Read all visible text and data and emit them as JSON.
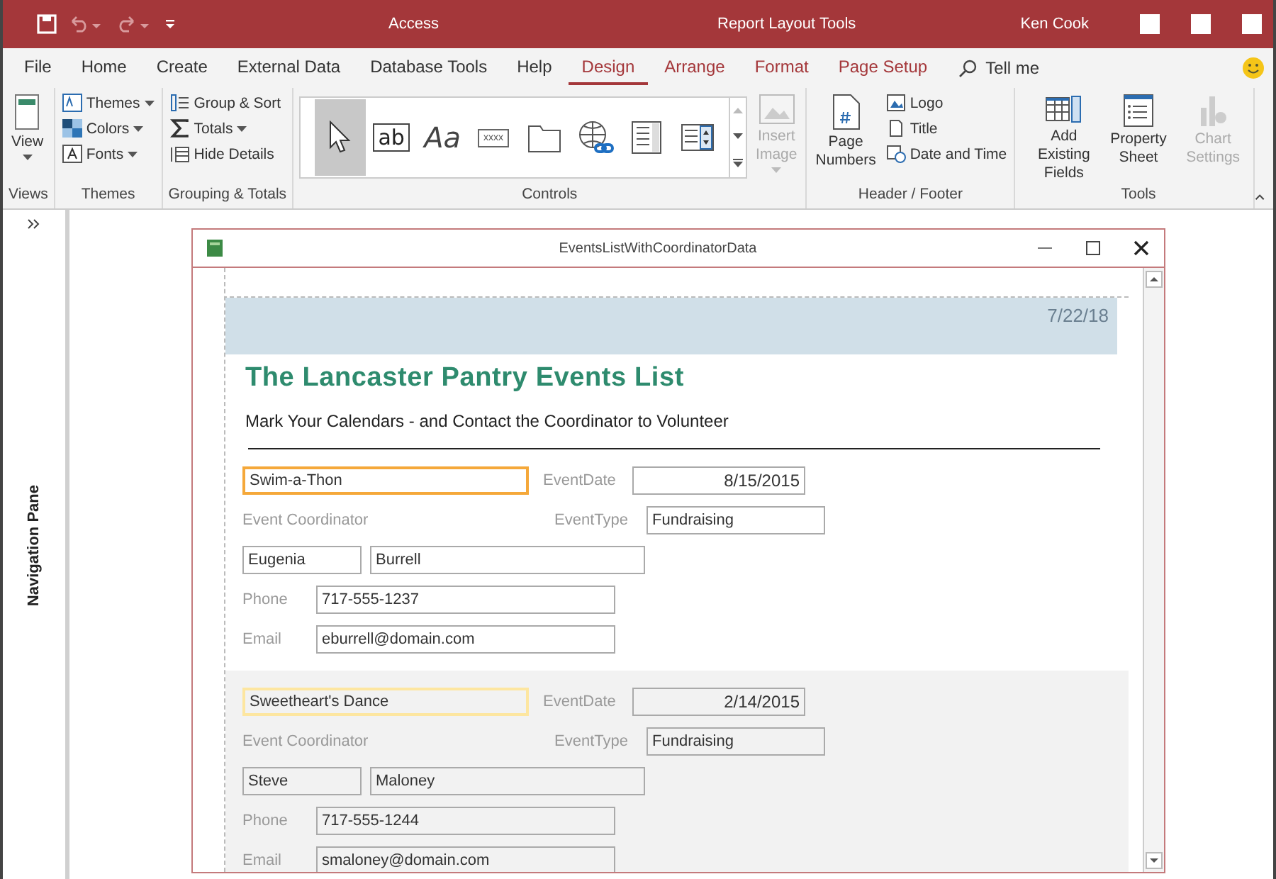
{
  "title_bar": {
    "app": "Access",
    "context": "Report Layout Tools",
    "user": "Ken Cook"
  },
  "tabs": [
    {
      "label": "File",
      "selected": false,
      "contextual": false
    },
    {
      "label": "Home",
      "selected": false,
      "contextual": false
    },
    {
      "label": "Create",
      "selected": false,
      "contextual": false
    },
    {
      "label": "External Data",
      "selected": false,
      "contextual": false
    },
    {
      "label": "Database Tools",
      "selected": false,
      "contextual": false
    },
    {
      "label": "Help",
      "selected": false,
      "contextual": false
    },
    {
      "label": "Design",
      "selected": true,
      "contextual": true
    },
    {
      "label": "Arrange",
      "selected": false,
      "contextual": true
    },
    {
      "label": "Format",
      "selected": false,
      "contextual": true
    },
    {
      "label": "Page Setup",
      "selected": false,
      "contextual": true
    }
  ],
  "tell_me": {
    "placeholder": "Tell me"
  },
  "ribbon": {
    "views": {
      "button": "View",
      "group": "Views"
    },
    "themes": {
      "items": [
        "Themes",
        "Colors",
        "Fonts"
      ],
      "group": "Themes"
    },
    "grouping": {
      "items": [
        "Group & Sort",
        "Totals",
        "Hide Details"
      ],
      "group": "Grouping & Totals"
    },
    "controls": {
      "items": [
        {
          "kind": "pointer",
          "selected": true
        },
        {
          "kind": "textbox",
          "text": "ab",
          "selected": false
        },
        {
          "kind": "label",
          "text": "Aa",
          "selected": false
        },
        {
          "kind": "button",
          "text": "xxxx",
          "selected": false
        },
        {
          "kind": "tab",
          "selected": false
        },
        {
          "kind": "hyperlink",
          "selected": false
        },
        {
          "kind": "listbox",
          "selected": false
        },
        {
          "kind": "combobox",
          "selected": false
        }
      ],
      "insert_image": {
        "label": "Insert Image",
        "disabled": true
      },
      "group": "Controls"
    },
    "header_footer": {
      "page_numbers": "Page Numbers",
      "items": [
        "Logo",
        "Title",
        "Date and Time"
      ],
      "group": "Header / Footer"
    },
    "tools": {
      "items": [
        {
          "label": "Add Existing Fields",
          "disabled": false
        },
        {
          "label": "Property Sheet",
          "disabled": false
        },
        {
          "label": "Chart Settings",
          "disabled": true
        }
      ],
      "group": "Tools"
    }
  },
  "navigation_pane": {
    "label": "Navigation Pane"
  },
  "report_window": {
    "title": "EventsListWithCoordinatorData"
  },
  "report": {
    "date": "7/22/18",
    "title": "The Lancaster Pantry Events List",
    "subtitle": "Mark Your Calendars - and Contact the Coordinator to Volunteer",
    "records": [
      {
        "selected": true,
        "name": "Swim-a-Thon",
        "date_label": "EventDate",
        "date": "8/15/2015",
        "coordinator_label": "Event Coordinator",
        "type_label": "EventType",
        "type": "Fundraising",
        "first": "Eugenia",
        "last": "Burrell",
        "phone_label": "Phone",
        "phone": "717-555-1237",
        "email_label": "Email",
        "email": "eburrell@domain.com"
      },
      {
        "selected": false,
        "name": "Sweetheart's Dance",
        "date_label": "EventDate",
        "date": "2/14/2015",
        "coordinator_label": "Event Coordinator",
        "type_label": "EventType",
        "type": "Fundraising",
        "first": "Steve",
        "last": "Maloney",
        "phone_label": "Phone",
        "phone": "717-555-1244",
        "email_label": "Email",
        "email": "smaloney@domain.com"
      }
    ]
  }
}
